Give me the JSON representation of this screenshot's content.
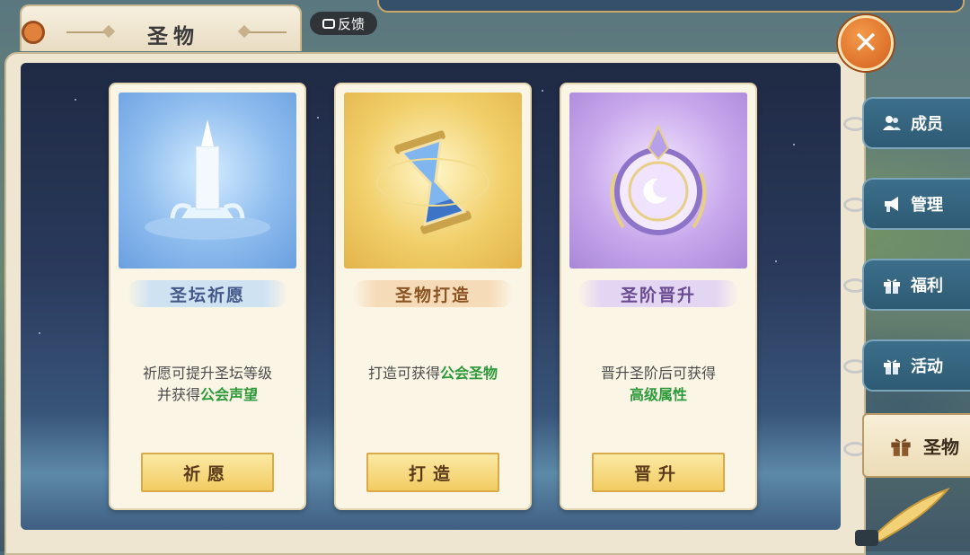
{
  "window": {
    "title": "圣物",
    "feedback_label": "反馈",
    "close_icon": "close-icon"
  },
  "cards": [
    {
      "name": "圣坛祈愿",
      "desc_line1": "祈愿可提升圣坛等级",
      "desc_line2_prefix": "并获得",
      "desc_line2_highlight": "公会声望",
      "button": "祈愿",
      "art": "altar-icon",
      "theme": "blue"
    },
    {
      "name": "圣物打造",
      "desc_line1_prefix": "打造可获得",
      "desc_line1_highlight": "公会圣物",
      "button": "打造",
      "art": "hourglass-icon",
      "theme": "gold"
    },
    {
      "name": "圣阶晋升",
      "desc_line1": "晋升圣阶后可获得",
      "desc_line2_highlight": "高级属性",
      "button": "晋升",
      "art": "emblem-icon",
      "theme": "purple"
    }
  ],
  "sidebar": {
    "items": [
      {
        "label": "成员",
        "icon": "members-icon"
      },
      {
        "label": "管理",
        "icon": "megaphone-icon"
      },
      {
        "label": "福利",
        "icon": "gift-icon"
      },
      {
        "label": "活动",
        "icon": "gift-icon"
      }
    ],
    "active": {
      "label": "圣物",
      "icon": "gift-icon"
    }
  },
  "colors": {
    "highlight": "#2d9a3a",
    "button": "#f2cc62",
    "close": "#d4601e"
  }
}
